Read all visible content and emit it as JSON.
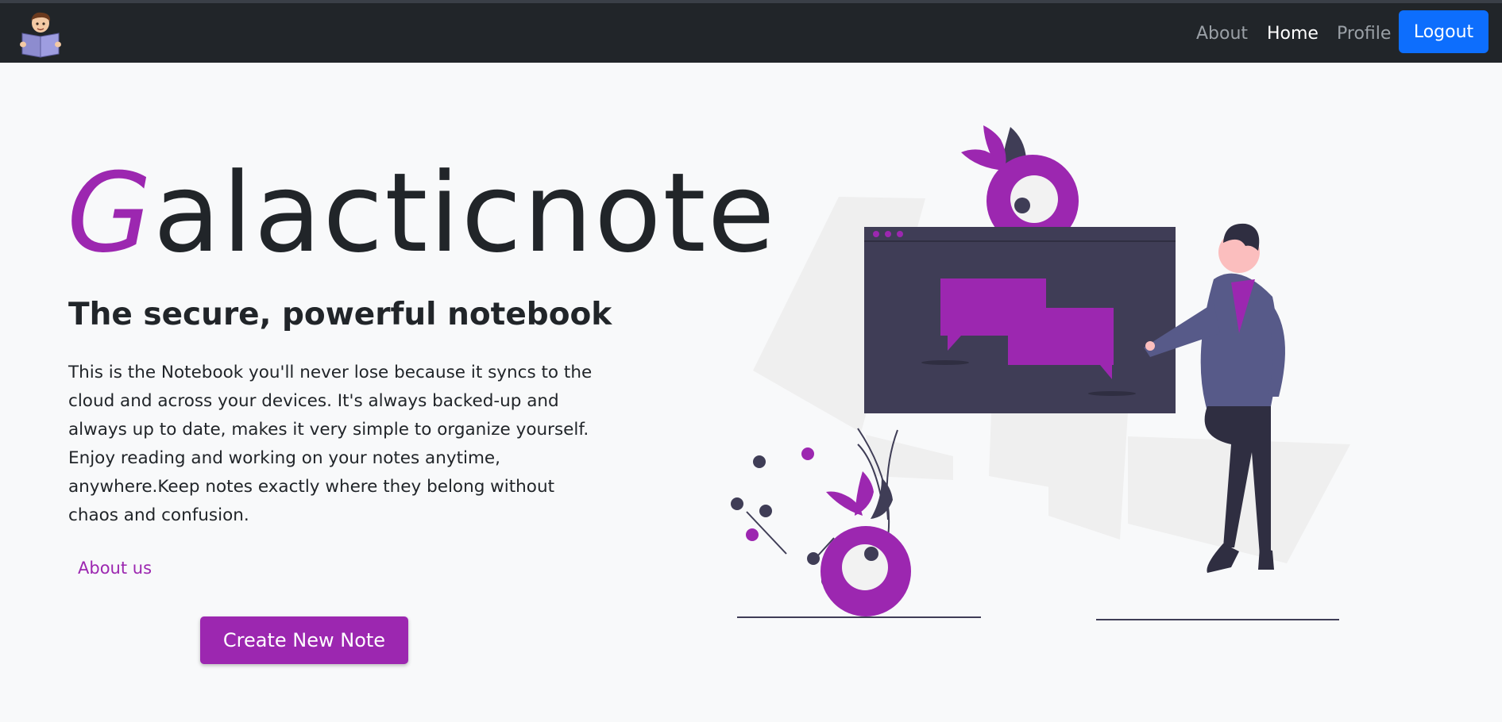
{
  "nav": {
    "links": [
      {
        "label": "About",
        "active": false
      },
      {
        "label": "Home",
        "active": true
      },
      {
        "label": "Profile",
        "active": false
      }
    ],
    "logout_label": "Logout"
  },
  "hero": {
    "title_first": "G",
    "title_rest": "alacticnote",
    "subtitle": "The secure, powerful notebook",
    "description": "This is the Notebook you'll never lose because it syncs to the cloud and across your devices. It's always backed-up and always up to date, makes it very simple to organize yourself. Enjoy reading and working on your notes anytime, anywhere.Keep notes exactly where they belong without chaos and confusion.",
    "about_link": "About us",
    "create_button": "Create New Note"
  },
  "icons": {
    "logo": "reading-person-logo-icon",
    "illustration": "notebook-chat-illustration"
  },
  "colors": {
    "navbar_bg": "#212529",
    "accent": "#9c27b0",
    "logout_bg": "#0d6efd",
    "page_bg": "#f8f9fa"
  }
}
